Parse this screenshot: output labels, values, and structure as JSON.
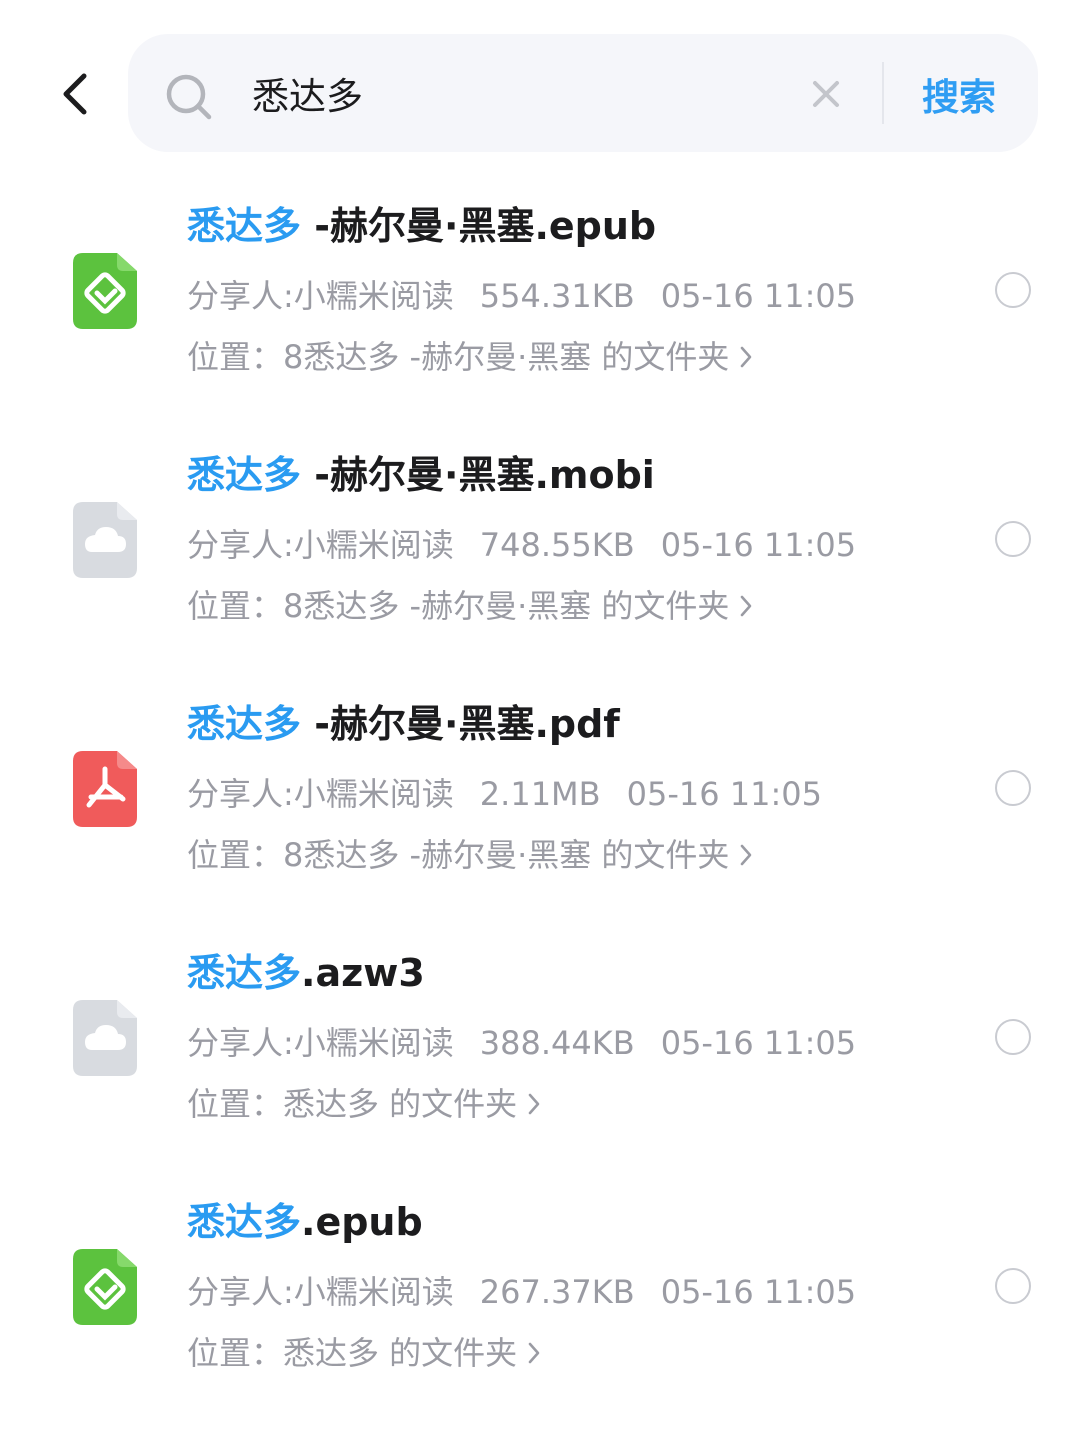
{
  "search": {
    "query": "悉达多",
    "button_label": "搜索"
  },
  "results": [
    {
      "file_type": "epub",
      "icon": "ebook-epub-icon",
      "title_highlight": "悉达多",
      "title_rest": " -赫尔曼·黑塞.epub",
      "sharer": "分享人:小糯米阅读",
      "size": "554.31KB",
      "date": "05-16 11:05",
      "location": "位置：8悉达多 -赫尔曼·黑塞 的文件夹"
    },
    {
      "file_type": "mobi",
      "icon": "cloud-file-icon",
      "title_highlight": "悉达多",
      "title_rest": " -赫尔曼·黑塞.mobi",
      "sharer": "分享人:小糯米阅读",
      "size": "748.55KB",
      "date": "05-16 11:05",
      "location": "位置：8悉达多 -赫尔曼·黑塞 的文件夹"
    },
    {
      "file_type": "pdf",
      "icon": "pdf-file-icon",
      "title_highlight": "悉达多",
      "title_rest": " -赫尔曼·黑塞.pdf",
      "sharer": "分享人:小糯米阅读",
      "size": "2.11MB",
      "date": "05-16 11:05",
      "location": "位置：8悉达多 -赫尔曼·黑塞 的文件夹"
    },
    {
      "file_type": "azw3",
      "icon": "cloud-file-icon",
      "title_highlight": "悉达多",
      "title_rest": ".azw3",
      "sharer": "分享人:小糯米阅读",
      "size": "388.44KB",
      "date": "05-16 11:05",
      "location": "位置：悉达多 的文件夹"
    },
    {
      "file_type": "epub",
      "icon": "ebook-epub-icon",
      "title_highlight": "悉达多",
      "title_rest": ".epub",
      "sharer": "分享人:小糯米阅读",
      "size": "267.37KB",
      "date": "05-16 11:05",
      "location": "位置：悉达多 的文件夹"
    }
  ],
  "colors": {
    "accent": "#2a9bf1",
    "epub_green": "#5cc23e",
    "pdf_red": "#f05b5b",
    "cloud_gray": "#d8dbe0",
    "meta_gray": "#9a9ba3"
  }
}
